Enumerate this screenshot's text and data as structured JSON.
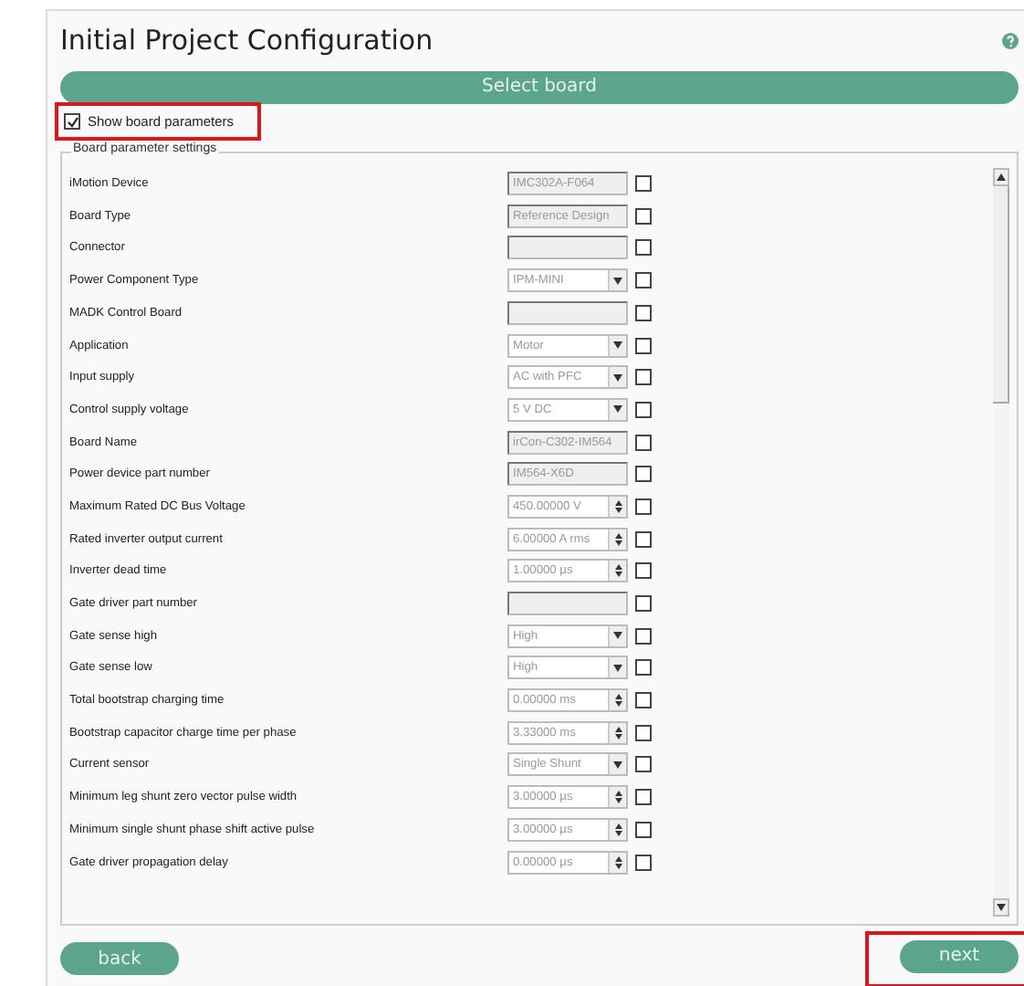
{
  "title": "Initial Project Configuration",
  "select_board": {
    "label": "Select board"
  },
  "show_parameters": {
    "label": "Show board parameters",
    "checked": true,
    "highlighted": true
  },
  "group": {
    "title": "Board parameter settings"
  },
  "parameters": [
    {
      "label": "iMotion Device",
      "kind": "text",
      "value": "IMC302A-F064",
      "checked": false
    },
    {
      "label": "Board Type",
      "kind": "text",
      "value": "Reference Design",
      "checked": false
    },
    {
      "label": "Connector",
      "kind": "text",
      "checked": false
    },
    {
      "label": "Power Component Type",
      "kind": "combo",
      "value": "IPM-MINI",
      "checked": false
    },
    {
      "label": "MADK Control Board",
      "kind": "text",
      "checked": false
    },
    {
      "label": "Application",
      "kind": "combo",
      "value": "Motor",
      "checked": false
    },
    {
      "label": "Input supply",
      "kind": "combo",
      "value": "AC with PFC",
      "checked": false
    },
    {
      "label": "Control supply voltage",
      "kind": "combo",
      "value": "5 V DC",
      "checked": false
    },
    {
      "label": "Board Name",
      "kind": "text",
      "value": "irCon-C302-IM564",
      "checked": false
    },
    {
      "label": "Power device part number",
      "kind": "text",
      "value": "IM564-X6D",
      "checked": false
    },
    {
      "label": "Maximum Rated DC Bus Voltage",
      "kind": "spin",
      "value": "450.00000 V",
      "checked": false
    },
    {
      "label": "Rated inverter output current",
      "kind": "spin",
      "value": "6.00000 A rms",
      "checked": false
    },
    {
      "label": "Inverter dead time",
      "kind": "spin",
      "value": "1.00000 µs",
      "checked": false
    },
    {
      "label": "Gate driver part number",
      "kind": "text",
      "checked": false
    },
    {
      "label": "Gate sense high",
      "kind": "combo",
      "value": "High",
      "checked": false
    },
    {
      "label": "Gate sense low",
      "kind": "combo",
      "value": "High",
      "checked": false
    },
    {
      "label": "Total bootstrap charging time",
      "kind": "spin",
      "value": "0.00000 ms",
      "checked": false
    },
    {
      "label": "Bootstrap capacitor charge time per phase",
      "kind": "spin",
      "value": "3.33000 ms",
      "checked": false
    },
    {
      "label": "Current sensor",
      "kind": "combo",
      "value": "Single Shunt",
      "checked": false
    },
    {
      "label": "Minimum leg shunt zero vector pulse width",
      "kind": "spin",
      "value": "3.00000 µs",
      "checked": false
    },
    {
      "label": "Minimum single shunt phase shift active pulse",
      "kind": "spin",
      "value": "3.00000 µs",
      "checked": false
    },
    {
      "label": "Gate driver propagation delay",
      "kind": "spin",
      "value": "0.00000 µs",
      "checked": false
    }
  ],
  "buttons": [
    {
      "label": "back",
      "kind": "back",
      "highlighted": false
    },
    {
      "label": "next",
      "kind": "next",
      "highlighted": true
    }
  ]
}
